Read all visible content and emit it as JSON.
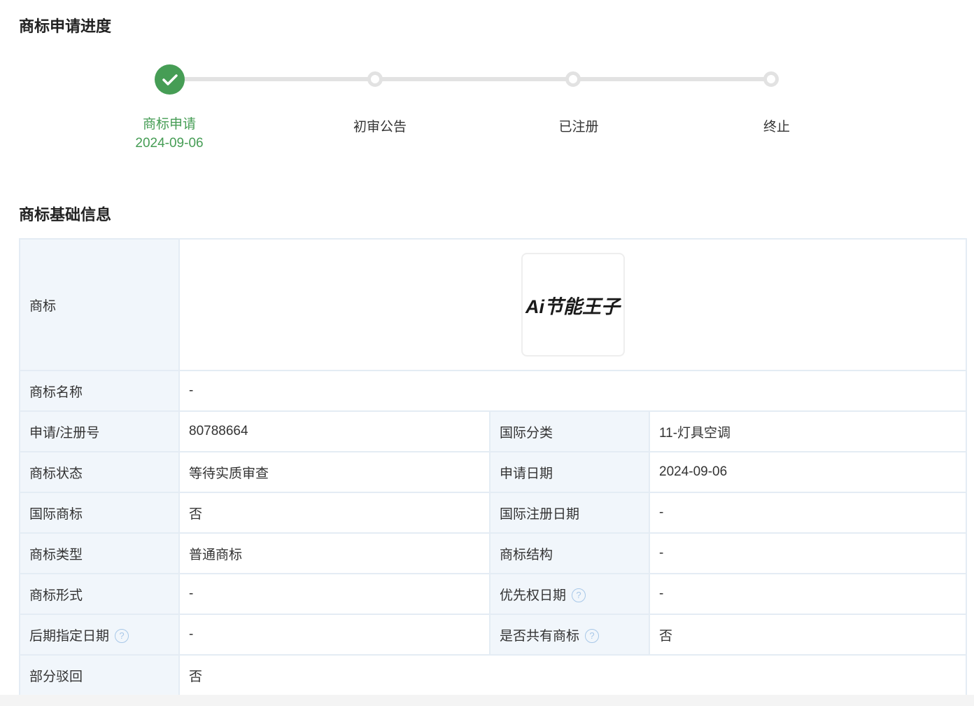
{
  "progress": {
    "title": "商标申请进度",
    "steps": [
      {
        "label": "商标申请",
        "date": "2024-09-06",
        "done": true
      },
      {
        "label": "初审公告"
      },
      {
        "label": "已注册"
      },
      {
        "label": "终止"
      }
    ]
  },
  "info": {
    "title": "商标基础信息",
    "logo_label": "商标",
    "logo_text": "Ai节能王子",
    "name_label": "商标名称",
    "name_value": "-",
    "rows": [
      {
        "l1": "申请/注册号",
        "v1": "80788664",
        "l2": "国际分类",
        "v2": "11-灯具空调"
      },
      {
        "l1": "商标状态",
        "v1": "等待实质审查",
        "l2": "申请日期",
        "v2": "2024-09-06"
      },
      {
        "l1": "国际商标",
        "v1": "否",
        "l2": "国际注册日期",
        "v2": "-"
      },
      {
        "l1": "商标类型",
        "v1": "普通商标",
        "l2": "商标结构",
        "v2": "-"
      },
      {
        "l1": "商标形式",
        "v1": "-",
        "l2": "优先权日期",
        "v2": "-"
      },
      {
        "l1": "后期指定日期",
        "v1": "-",
        "l2": "是否共有商标",
        "v2": "否"
      }
    ],
    "last_label": "部分驳回",
    "last_value": "否",
    "help": "?"
  }
}
